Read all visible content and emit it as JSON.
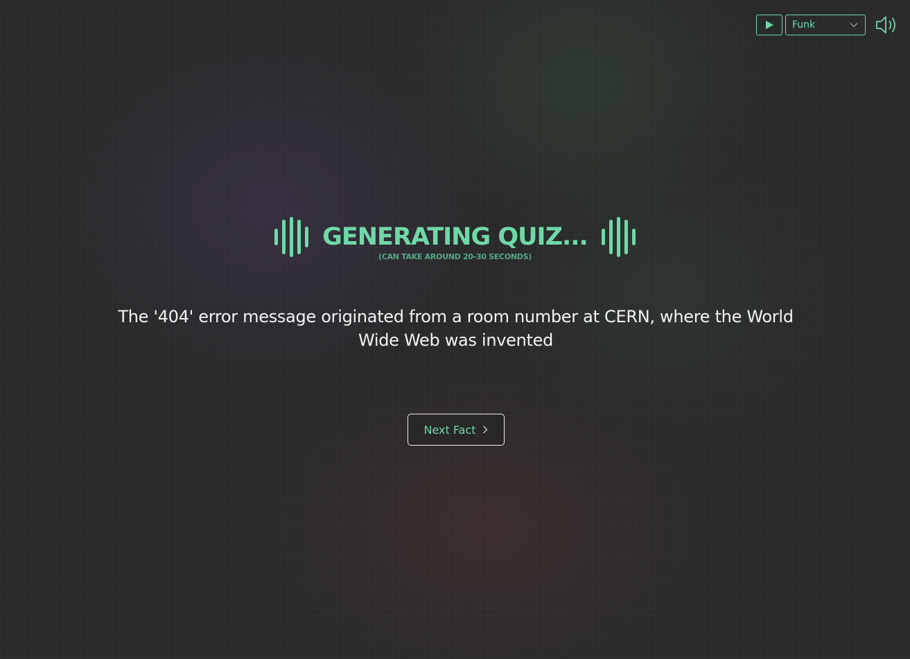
{
  "music": {
    "play_icon": "play-icon",
    "selected_track": "Funk",
    "dropdown_icon": "chevron-down-icon",
    "volume_icon": "speaker-volume-icon"
  },
  "loading": {
    "title": "GENERATING QUIZ...",
    "subtitle": "(CAN TAKE AROUND 20-30 SECONDS)",
    "wave_icon": "sound-wave-icon"
  },
  "fact": {
    "text": "The '404' error message originated from a room number at CERN, where the World Wide Web was invented"
  },
  "next_button": {
    "label": "Next Fact",
    "icon": "chevron-right-icon"
  },
  "colors": {
    "accent": "#6fd9a8",
    "background": "#2a2a2b",
    "text": "#f4f4f4"
  }
}
